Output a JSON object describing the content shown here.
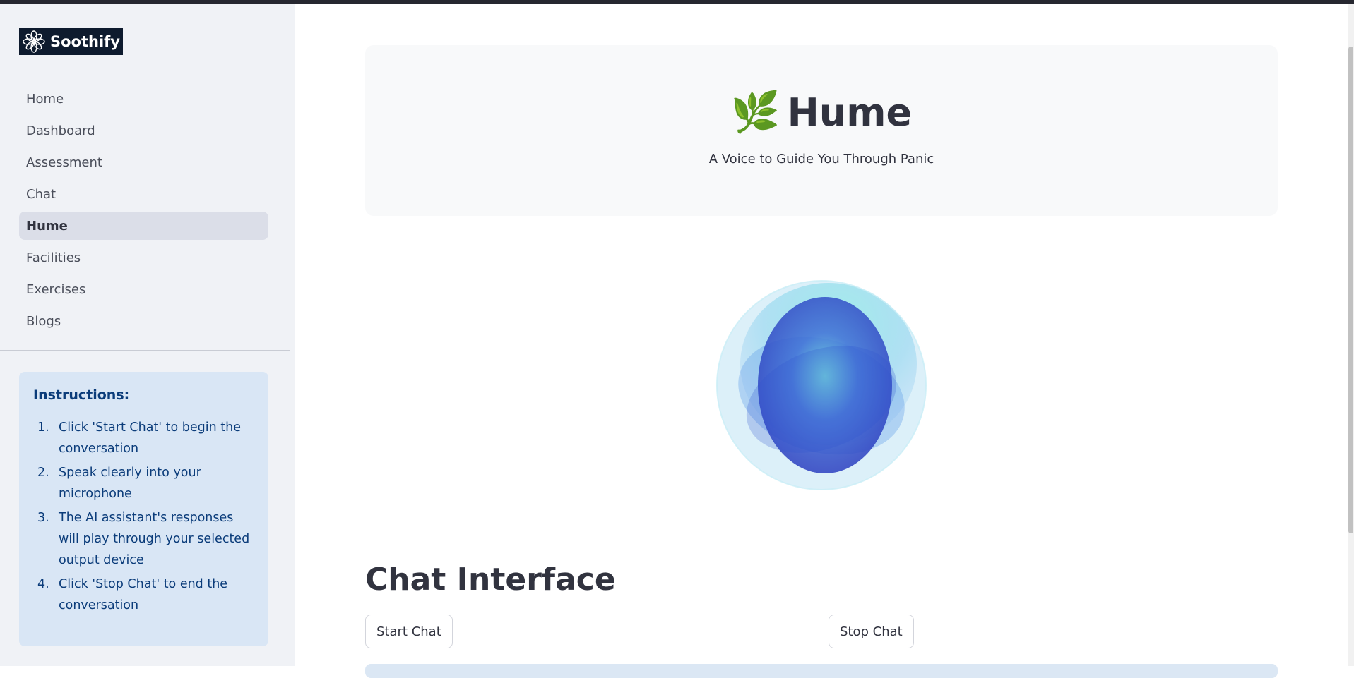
{
  "app": {
    "brand": "Soothify",
    "logo_icon": "flower-icon"
  },
  "sidebar": {
    "items": [
      {
        "label": "Home",
        "active": false
      },
      {
        "label": "Dashboard",
        "active": false
      },
      {
        "label": "Assessment",
        "active": false
      },
      {
        "label": "Chat",
        "active": false
      },
      {
        "label": "Hume",
        "active": true
      },
      {
        "label": "Facilities",
        "active": false
      },
      {
        "label": "Exercises",
        "active": false
      },
      {
        "label": "Blogs",
        "active": false
      }
    ],
    "instructions": {
      "title": "Instructions:",
      "steps": [
        {
          "num": "1.",
          "text": "Click 'Start Chat' to begin the conversation"
        },
        {
          "num": "2.",
          "text": "Speak clearly into your microphone"
        },
        {
          "num": "3.",
          "text": "The AI assistant's responses will play through your selected output device"
        },
        {
          "num": "4.",
          "text": "Click 'Stop Chat' to end the conversation"
        }
      ]
    }
  },
  "main": {
    "hero": {
      "icon": "🌿",
      "title": "Hume",
      "subtitle": "A Voice to Guide You Through Panic"
    },
    "chat_heading": "Chat Interface",
    "start_label": "Start Chat",
    "stop_label": "Stop Chat"
  },
  "colors": {
    "sidebar_bg": "#f0f2f6",
    "active_nav_bg": "#dbdee8",
    "instructions_bg": "#d9e6f5",
    "instructions_text": "#0b3c7a",
    "logo_bg": "#0e1b2e"
  }
}
